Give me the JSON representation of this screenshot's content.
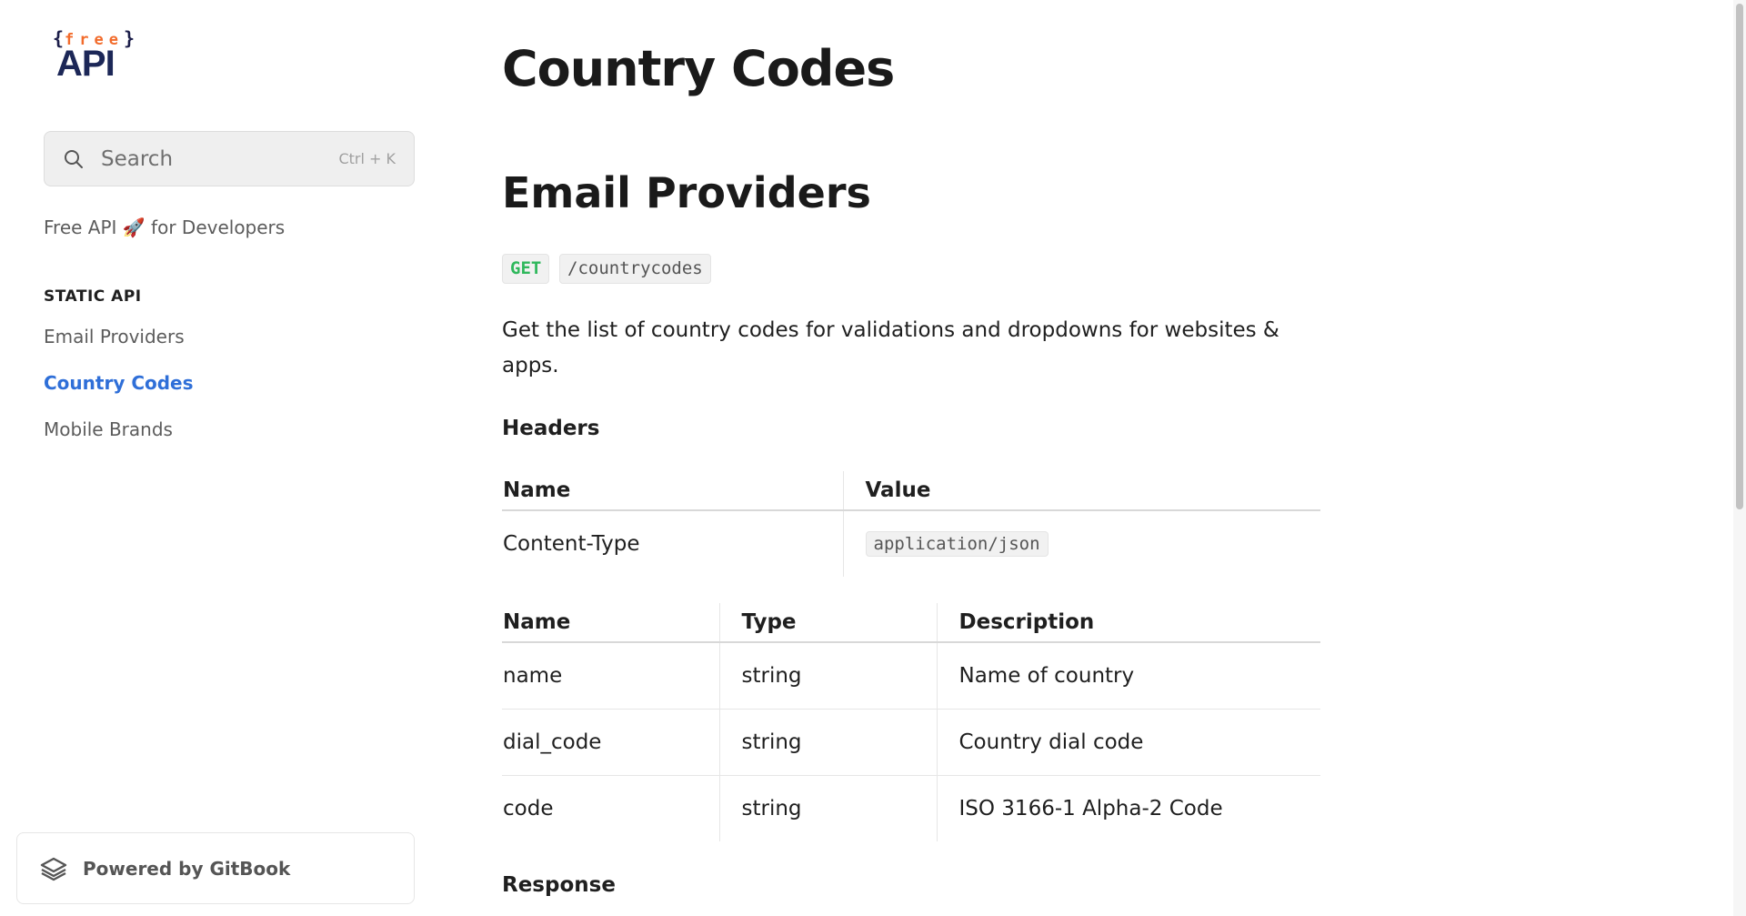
{
  "logo": {
    "top_text": "{free}",
    "bottom_text": "API"
  },
  "search": {
    "placeholder": "Search",
    "shortcut": "Ctrl + K"
  },
  "sidebar": {
    "tagline": "Free API 🚀 for Developers",
    "section_title": "STATIC API",
    "items": [
      {
        "label": "Email Providers",
        "active": false
      },
      {
        "label": "Country Codes",
        "active": true
      },
      {
        "label": "Mobile Brands",
        "active": false
      }
    ],
    "powered_by": "Powered by GitBook"
  },
  "main": {
    "page_title": "Country Codes",
    "section_title": "Email Providers",
    "method": "GET",
    "path": "/countrycodes",
    "description": "Get the list of country codes for validations and dropdowns for websites & apps.",
    "headers_title": "Headers",
    "headers_table": {
      "columns": [
        "Name",
        "Value"
      ],
      "rows": [
        [
          "Content-Type",
          "application/json"
        ]
      ]
    },
    "fields_table": {
      "columns": [
        "Name",
        "Type",
        "Description"
      ],
      "rows": [
        [
          "name",
          "string",
          "Name of country"
        ],
        [
          "dial_code",
          "string",
          "Country dial code"
        ],
        [
          "code",
          "string",
          "ISO 3166-1 Alpha-2 Code"
        ]
      ]
    },
    "response_title": "Response"
  },
  "colors": {
    "accent": "#2f6fd8",
    "method_get": "#2fb85c",
    "logo_orange": "#f26b2b",
    "logo_navy": "#1c2757"
  }
}
